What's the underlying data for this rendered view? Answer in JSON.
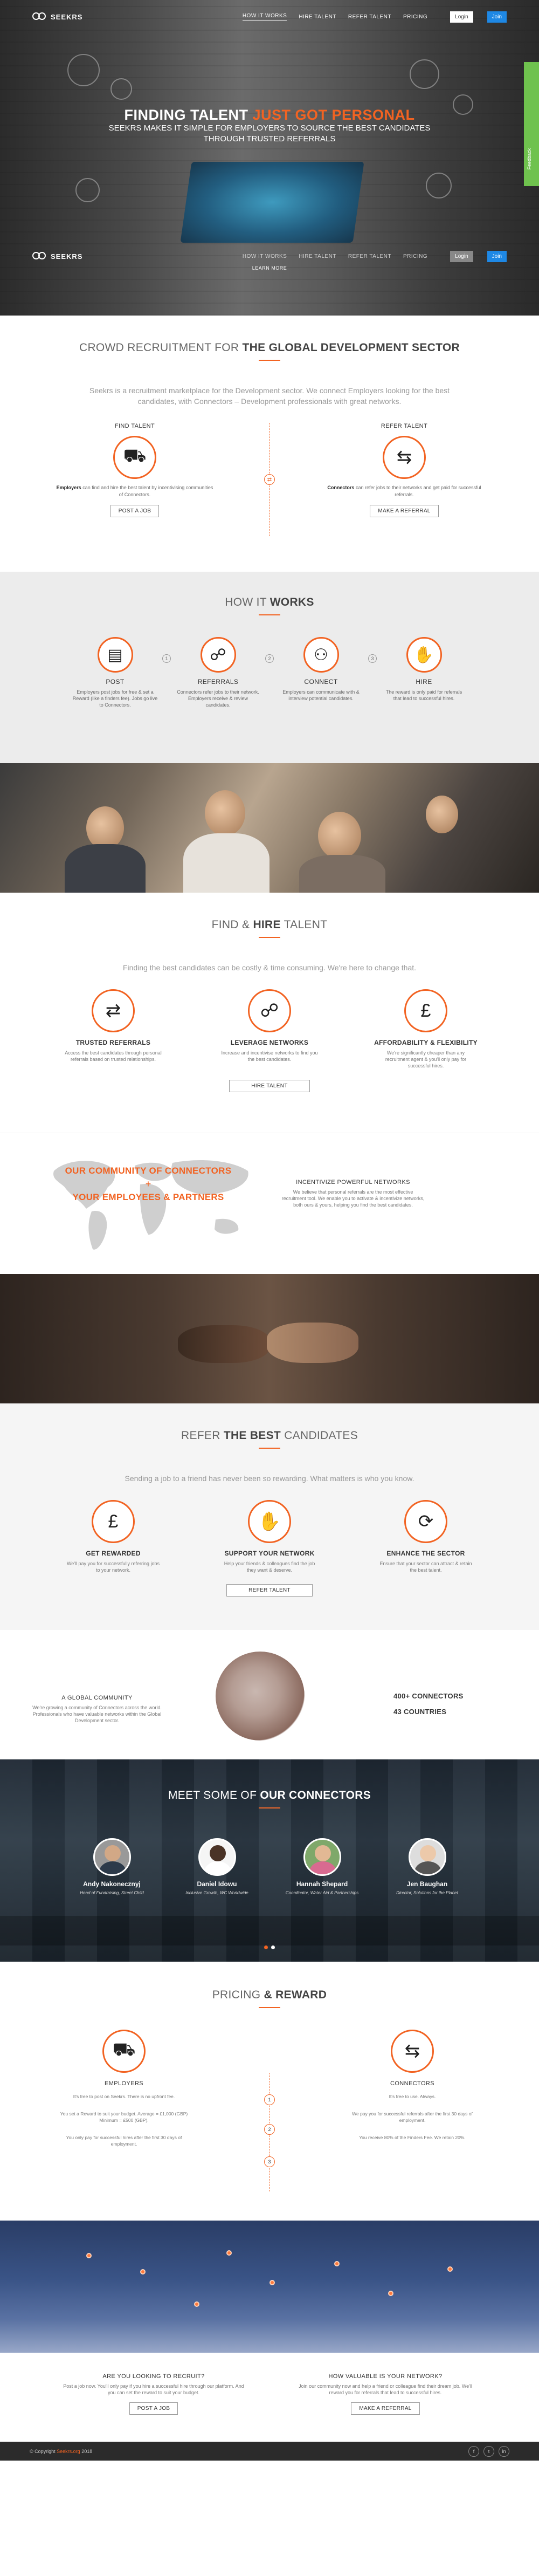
{
  "brand": {
    "name": "SEEKRS"
  },
  "nav": {
    "links": [
      "HOW IT WORKS",
      "HIRE TALENT",
      "REFER TALENT",
      "PRICING"
    ],
    "login": "Login",
    "join": "Join"
  },
  "hero": {
    "title_a": "FINDING TALENT",
    "title_b": "JUST GOT PERSONAL",
    "subtitle": "SEEKRS MAKES IT SIMPLE FOR EMPLOYERS TO SOURCE THE BEST CANDIDATES THROUGH TRUSTED REFERRALS",
    "learn_more": "LEARN MORE",
    "side_tab": "Feedback"
  },
  "crowd": {
    "title_a": "CROWD RECRUITMENT FOR",
    "title_b": "THE GLOBAL DEVELOPMENT SECTOR",
    "lead": "Seekrs is a recruitment marketplace for the Development sector. We connect Employers looking for the best candidates, with Connectors – Development professionals with great networks.",
    "find": {
      "heading": "FIND TALENT",
      "bold": "Employers",
      "text": " can find and hire the best talent by incentivising communities of Connectors.",
      "button": "POST A JOB"
    },
    "refer": {
      "heading": "REFER TALENT",
      "bold": "Connectors",
      "text": " can refer jobs to their networks and get paid for successful referrals.",
      "button": "MAKE A REFERRAL"
    }
  },
  "how": {
    "title_a": "HOW IT",
    "title_b": "WORKS",
    "steps": [
      {
        "title": "POST",
        "text": "Employers post jobs for free & set a Reward (like a finders fee). Jobs go live to Connectors."
      },
      {
        "title": "REFERRALS",
        "text": "Connectors refer jobs to their network. Employers receive & review candidates."
      },
      {
        "title": "CONNECT",
        "text": "Employers can communicate with & interview potential candidates."
      },
      {
        "title": "HIRE",
        "text": "The reward is only paid for referrals that lead to successful hires."
      }
    ],
    "numbers": [
      "1",
      "2",
      "3"
    ]
  },
  "hire": {
    "title_a": "FIND &",
    "title_b": "HIRE",
    "title_c": "TALENT",
    "lead": "Finding the best candidates can be costly & time consuming. We're here to change that.",
    "cols": [
      {
        "title": "TRUSTED REFERRALS",
        "text": "Access the best candidates through personal referrals based on trusted relationships."
      },
      {
        "title": "LEVERAGE NETWORKS",
        "text": "Increase and incentivise networks to find you the best candidates."
      },
      {
        "title": "AFFORDABILITY & FLEXIBILITY",
        "text": "We're significantly cheaper than any recruitment agent & you'll only pay for successful hires."
      }
    ],
    "button": "HIRE TALENT"
  },
  "community": {
    "line1": "OUR COMMUNITY OF CONNECTORS",
    "plus": "+",
    "line2": "YOUR EMPLOYEES & PARTNERS",
    "heading": "INCENTIVIZE POWERFUL NETWORKS",
    "text": "We believe that personal referrals are the most effective recruitment tool. We enable you to activate & incentivize networks, both ours & yours, helping you find the best candidates."
  },
  "refer": {
    "title_a": "REFER",
    "title_b": "THE BEST",
    "title_c": "CANDIDATES",
    "lead": "Sending a job to a friend has never been so rewarding. What matters is who you know.",
    "cols": [
      {
        "title": "GET REWARDED",
        "text": "We'll pay you for successfully referring jobs to your network."
      },
      {
        "title": "SUPPORT YOUR NETWORK",
        "text": "Help your friends & colleagues find the job they want & deserve."
      },
      {
        "title": "ENHANCE THE SECTOR",
        "text": "Ensure that your sector can attract & retain the best talent."
      }
    ],
    "button": "REFER TALENT"
  },
  "global": {
    "heading": "A GLOBAL COMMUNITY",
    "text": "We're growing a community of Connectors across the world. Professionals who have valuable networks within the Global Development sector.",
    "connectors": "400+ CONNECTORS",
    "countries": "43 COUNTRIES"
  },
  "connectors": {
    "title_a": "MEET SOME OF",
    "title_b": "OUR CONNECTORS",
    "people": [
      {
        "name": "Andy Nakonecznyj",
        "role": "Head of Fundraising, Street Child"
      },
      {
        "name": "Daniel Idowu",
        "role": "Inclusive Growth, WC Worldwide"
      },
      {
        "name": "Hannah Shepard",
        "role": "Coordinator, Water Aid & Partnerships"
      },
      {
        "name": "Jen Baughan",
        "role": "Director, Solutions for the Planet"
      }
    ]
  },
  "pricing": {
    "title_a": "PRICING",
    "title_b": "& REWARD",
    "employers": {
      "heading": "EMPLOYERS",
      "items": [
        "It's free to post on Seekrs. There is no upfront fee.",
        "You set a Reward to suit your budget. Average = £1,000 (GBP) Minimum = £500 (GBP).",
        "You only pay for successful hires after the first 30 days of employment."
      ]
    },
    "connectors": {
      "heading": "CONNECTORS",
      "items": [
        "It's free to use. Always.",
        "We pay you for successful referrals after the first 30 days of employment.",
        "You receive 80% of the Finders Fee. We retain 20%."
      ]
    },
    "numbers": [
      "1",
      "2",
      "3"
    ]
  },
  "cta": {
    "recruit": {
      "heading": "ARE YOU LOOKING TO RECRUIT?",
      "text": "Post a job now. You'll only pay if you hire a successful hire through our platform. And you can set the reward to suit your budget.",
      "button": "POST A JOB"
    },
    "network": {
      "heading": "HOW VALUABLE IS YOUR NETWORK?",
      "text": "Join our community now and help a friend or colleague find their dream job. We'll reward you for referrals that lead to successful hires.",
      "button": "MAKE A REFERRAL"
    }
  },
  "footer": {
    "copyright": "© Copyright",
    "brand": "Seekrs.org",
    "year": "2018",
    "socials": [
      "f",
      "t",
      "in"
    ]
  },
  "colors": {
    "accent": "#f26322",
    "join": "#1e88e5",
    "side_tab": "#6fc24e"
  }
}
